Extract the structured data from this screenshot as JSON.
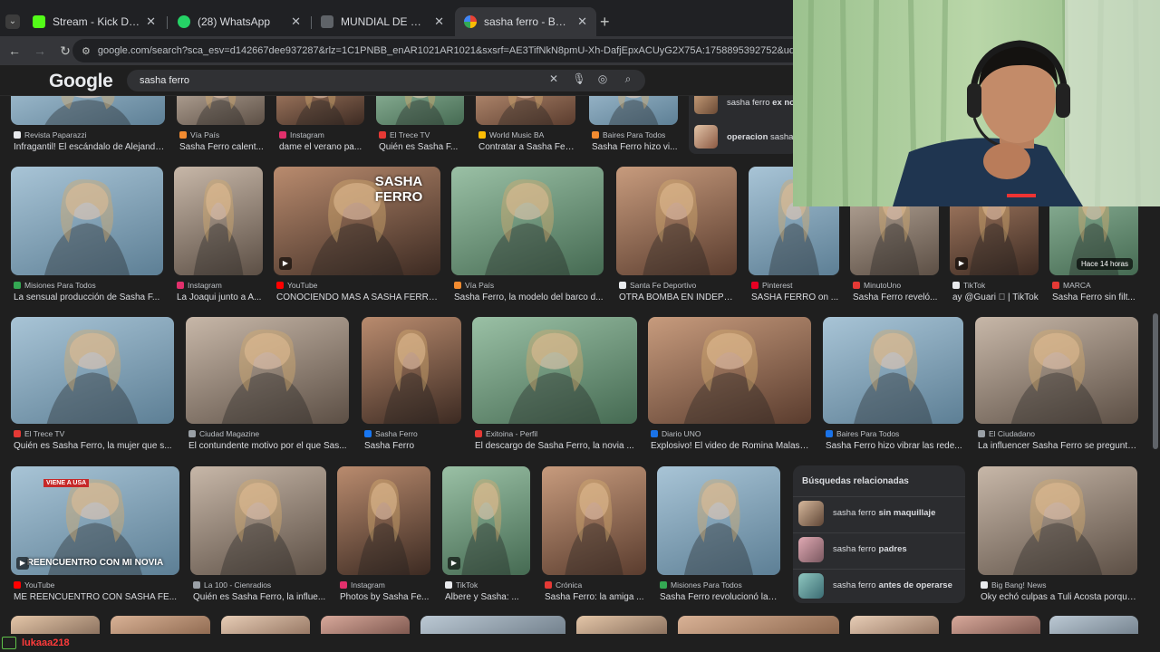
{
  "browser": {
    "tabs": [
      {
        "title": "Stream - Kick Dashboard",
        "favicon": "kick-icon",
        "color": "#53fc18",
        "active": false
      },
      {
        "title": "(28) WhatsApp",
        "favicon": "whatsapp-icon",
        "color": "#25d366",
        "active": false
      },
      {
        "title": "MUNDIAL DE CULOS Bracket - ...",
        "favicon": "bracket-icon",
        "color": "#9aa0a6",
        "active": false
      },
      {
        "title": "sasha ferro - Buscar con Google",
        "favicon": "google-icon",
        "color": "#4285f4",
        "active": true
      }
    ],
    "new_tab": "+",
    "url": "google.com/search?sca_esv=d142667dee937287&rlz=1C1PNBB_enAR1021AR1021&sxsrf=AE3TifNkN8pmU-Xh-DafjEpxACUyG2X75A:1758895392752&udm=2&fbs=AIIjpHx4nJjlGojPVHhE..."
  },
  "google": {
    "logo": "Google",
    "query": "sasha ferro"
  },
  "results": {
    "row0": [
      {
        "source": "Revista Paparazzi",
        "caption": "Infragantil! El escándalo de Alejandr...",
        "fav": "#e8eaed"
      },
      {
        "source": "Vía País",
        "caption": "Sasha Ferro calent...",
        "fav": "#f28b30"
      },
      {
        "source": "Instagram",
        "caption": "dame el verano pa...",
        "fav": "#e1306c"
      },
      {
        "source": "El Trece TV",
        "caption": "Quién es Sasha F...",
        "fav": "#e53935"
      },
      {
        "source": "World Music BA",
        "caption": "Contratar a Sasha Ferro",
        "fav": "#fbbc04"
      },
      {
        "source": "Baires Para Todos",
        "caption": "Sasha Ferro hizo vi...",
        "fav": "#f28b30"
      }
    ],
    "row1": [
      {
        "source": "Misiones Para Todos",
        "caption": "La sensual producción de Sasha F...",
        "fav": "#34a853"
      },
      {
        "source": "Instagram",
        "caption": "La Joaqui junto a A...",
        "fav": "#e1306c"
      },
      {
        "source": "YouTube",
        "caption": "CONOCIENDO MAS A SASHA FERRO...",
        "fav": "#ff0000",
        "overlay_text": "SASHA FERRO"
      },
      {
        "source": "Vía País",
        "caption": "Sasha Ferro, la modelo del barco d...",
        "fav": "#f28b30"
      },
      {
        "source": "Santa Fe Deportivo",
        "caption": "OTRA BOMBA EN INDEPE...",
        "fav": "#e8eaed"
      },
      {
        "source": "Pinterest",
        "caption": "SASHA FERRO on ...",
        "fav": "#e60023"
      },
      {
        "source": "MinutoUno",
        "caption": "Sasha Ferro reveló...",
        "fav": "#e53935"
      },
      {
        "source": "TikTok",
        "caption": "ay @Guari ⃞ | TikTok",
        "fav": "#e8eaed"
      },
      {
        "source": "MARCA",
        "caption": "Sasha Ferro sin filt...",
        "fav": "#e53935",
        "badge": "Hace 14 horas"
      }
    ],
    "row2": [
      {
        "source": "El Trece TV",
        "caption": "Quién es Sasha Ferro, la mujer que s...",
        "fav": "#e53935"
      },
      {
        "source": "Ciudad Magazine",
        "caption": "El contundente motivo por el que Sas...",
        "fav": "#9aa0a6"
      },
      {
        "source": "Sasha Ferro",
        "caption": "Sasha Ferro",
        "fav": "#1877f2"
      },
      {
        "source": "Exitoina - Perfil",
        "caption": "El descargo de Sasha Ferro, la novia ...",
        "fav": "#e53935"
      },
      {
        "source": "Diario UNO",
        "caption": "Explosivo! El video de Romina Malasp...",
        "fav": "#1a73e8"
      },
      {
        "source": "Baires Para Todos",
        "caption": "Sasha Ferro hizo vibrar las rede...",
        "fav": "#1a73e8"
      },
      {
        "source": "El Ciudadano",
        "caption": "La influencer Sasha Ferro se preguntó...",
        "fav": "#9aa0a6"
      }
    ],
    "row3": [
      {
        "source": "YouTube",
        "caption": "ME REENCUENTRO CON SASHA FE...",
        "fav": "#ff0000",
        "overlay_text": "REENCUENTRO CON MI NOVIA",
        "overlay_top": "VIENE A USA"
      },
      {
        "source": "La 100 - Cienradios",
        "caption": "Quién es Sasha Ferro, la influe...",
        "fav": "#9aa0a6"
      },
      {
        "source": "Instagram",
        "caption": "Photos by Sasha Fe...",
        "fav": "#e1306c"
      },
      {
        "source": "TikTok",
        "caption": "Albere y Sasha: ...",
        "fav": "#e8eaed"
      },
      {
        "source": "Crónica",
        "caption": "Sasha Ferro: la amiga ...",
        "fav": "#e53935"
      },
      {
        "source": "Misiones Para Todos",
        "caption": "Sasha Ferro revolucionó las ...",
        "fav": "#34a853"
      },
      {
        "source": "Big Bang! News",
        "caption": "Oky echó culpas a Tuli Acosta porque...",
        "fav": "#e8eaed"
      }
    ]
  },
  "related": {
    "title": "Búsquedas relacionadas",
    "items": [
      {
        "prefix": "sasha ferro",
        "bold": "sin maquillaje"
      },
      {
        "prefix": "sasha ferro",
        "bold": "padres"
      },
      {
        "prefix": "sasha ferro",
        "bold": "antes de operarse"
      }
    ],
    "top_items": [
      {
        "prefix": "sasha ferro",
        "bold": "ex no"
      },
      {
        "prefix": "",
        "bold": "operacion",
        "suffix": "sasha"
      }
    ]
  },
  "chat": {
    "user": "lukaaa218"
  }
}
